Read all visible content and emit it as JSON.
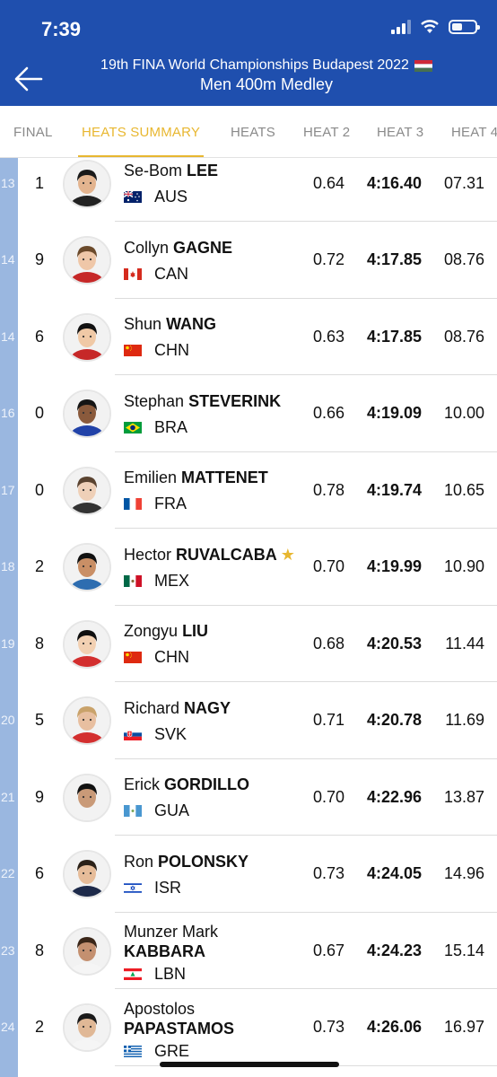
{
  "status": {
    "time": "7:39",
    "battery_level": 0.45
  },
  "header": {
    "title": "19th FINA World Championships Budapest 2022",
    "subtitle": "Men 400m Medley",
    "back_icon": "arrow-left-icon",
    "flag_icon": "flag-hungary-icon"
  },
  "tabs": [
    {
      "label": "FINAL",
      "active": false
    },
    {
      "label": "HEATS SUMMARY",
      "active": true
    },
    {
      "label": "HEATS",
      "active": false
    },
    {
      "label": "HEAT 2",
      "active": false
    },
    {
      "label": "HEAT 3",
      "active": false
    },
    {
      "label": "HEAT 4",
      "active": false
    }
  ],
  "colors": {
    "header_bg": "#1f4fae",
    "tab_active": "#e8b730",
    "rank_strip": "#9ab7e0",
    "star": "#e8b730"
  },
  "results": [
    {
      "rank": "13",
      "lane": "1",
      "first": "Se-Bom",
      "last": "LEE",
      "country": "AUS",
      "flag": "australia",
      "rt": "0.64",
      "time": "4:16.40",
      "diff": "07.31"
    },
    {
      "rank": "14",
      "lane": "9",
      "first": "Collyn",
      "last": "GAGNE",
      "country": "CAN",
      "flag": "canada",
      "rt": "0.72",
      "time": "4:17.85",
      "diff": "08.76"
    },
    {
      "rank": "14",
      "lane": "6",
      "first": "Shun",
      "last": "WANG",
      "country": "CHN",
      "flag": "china",
      "rt": "0.63",
      "time": "4:17.85",
      "diff": "08.76"
    },
    {
      "rank": "16",
      "lane": "0",
      "first": "Stephan",
      "last": "STEVERINK",
      "country": "BRA",
      "flag": "brazil",
      "rt": "0.66",
      "time": "4:19.09",
      "diff": "10.00"
    },
    {
      "rank": "17",
      "lane": "0",
      "first": "Emilien",
      "last": "MATTENET",
      "country": "FRA",
      "flag": "france",
      "rt": "0.78",
      "time": "4:19.74",
      "diff": "10.65"
    },
    {
      "rank": "18",
      "lane": "2",
      "first": "Hector",
      "last": "RUVALCABA",
      "star": true,
      "country": "MEX",
      "flag": "mexico",
      "rt": "0.70",
      "time": "4:19.99",
      "diff": "10.90"
    },
    {
      "rank": "19",
      "lane": "8",
      "first": "Zongyu",
      "last": "LIU",
      "country": "CHN",
      "flag": "china",
      "rt": "0.68",
      "time": "4:20.53",
      "diff": "11.44"
    },
    {
      "rank": "20",
      "lane": "5",
      "first": "Richard",
      "last": "NAGY",
      "country": "SVK",
      "flag": "slovakia",
      "rt": "0.71",
      "time": "4:20.78",
      "diff": "11.69"
    },
    {
      "rank": "21",
      "lane": "9",
      "first": "Erick",
      "last": "GORDILLO",
      "country": "GUA",
      "flag": "guatemala",
      "rt": "0.70",
      "time": "4:22.96",
      "diff": "13.87"
    },
    {
      "rank": "22",
      "lane": "6",
      "first": "Ron",
      "last": "POLONSKY",
      "country": "ISR",
      "flag": "israel",
      "rt": "0.73",
      "time": "4:24.05",
      "diff": "14.96"
    },
    {
      "rank": "23",
      "lane": "8",
      "first": "Munzer Mark",
      "last": "KABBARA",
      "country": "LBN",
      "flag": "lebanon",
      "rt": "0.67",
      "time": "4:24.23",
      "diff": "15.14"
    },
    {
      "rank": "24",
      "lane": "2",
      "first": "Apostolos",
      "last": "PAPASTAMOS",
      "country": "GRE",
      "flag": "greece",
      "rt": "0.73",
      "time": "4:26.06",
      "diff": "16.97"
    }
  ]
}
